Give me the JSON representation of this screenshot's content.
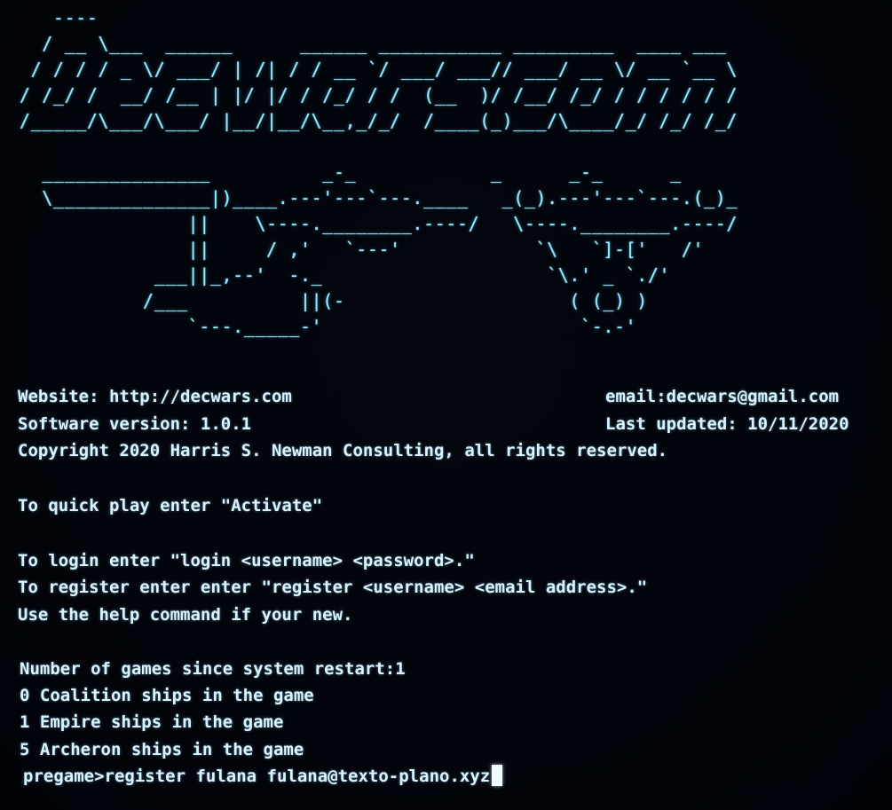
{
  "banner_art": "   ----\n  / __ \\___  ______      ______ ___________ _________  ____ ___\n / / / / _ \\/ ___/ | /| / / __ `/ ___/ ___// ___/ __ \\/ __ `__ \\\n/ /_/ /  __/ /__ | |/ |/ / /_/ / /  (__  )/ /__/ /_/ / / / / / /\n/_____/\\___/\\___/ |__/|__/\\__,_/_/  /____(_)___/\\____/_/ /_/ /_/",
  "ships_art": "  _______________          _-_            _      _-_      _\n  \\______________|)____.---'---`---.____   _(_).---'---`---.(_)_\n               ||    \\----.________.----/   \\----.________.----/\n               ||     / ,'   `---'            `\\   `]-['   /'\n            ___||_,--'  -._                    `\\.' _ `./'\n           /___          ||(-                    ( (_) )\n               `---._____-'                       `-.-'",
  "info": {
    "website": "Website: http://decwars.com",
    "email": "email:decwars@gmail.com",
    "version": "Software version: 1.0.1",
    "last_updated": "Last updated: 10/11/2020",
    "copyright": "Copyright 2020 Harris S. Newman Consulting, all rights reserved."
  },
  "instructions": {
    "quick_play": "To quick play enter \"Activate\"",
    "login": "To login enter \"login <username> <password>.\"",
    "register": "To register enter enter \"register <username> <email address>.\"",
    "help": "Use the help command if your new."
  },
  "status": {
    "games": "Number of games since system restart:1",
    "coalition": "0 Coalition ships in the game",
    "empire": "1 Empire ships in the game",
    "archeron": "5 Archeron ships in the game"
  },
  "prompt": {
    "prefix": "pregame>",
    "input": "register fulana fulana@texto-plano.xyz"
  }
}
